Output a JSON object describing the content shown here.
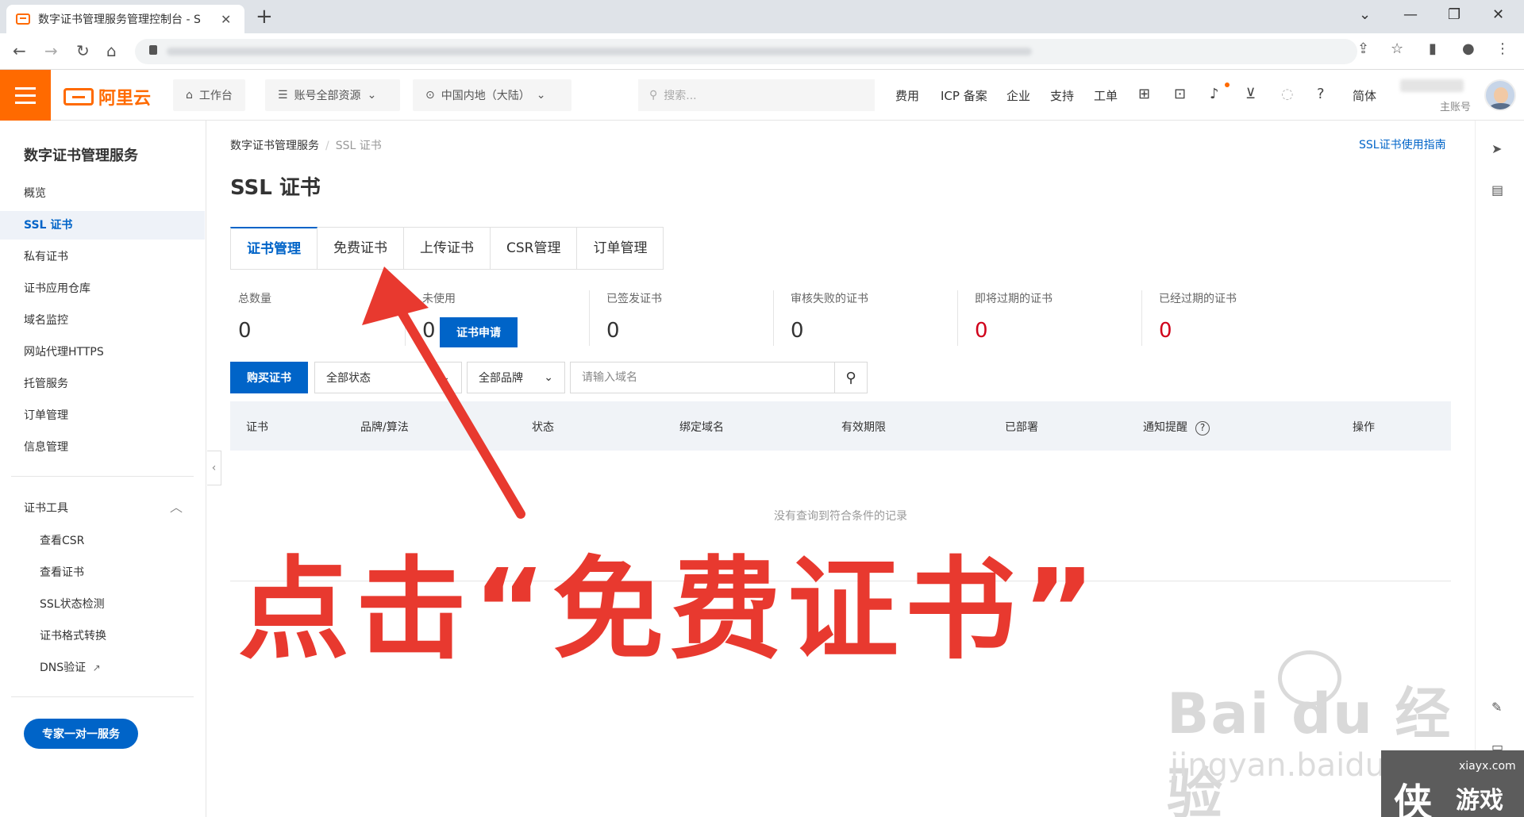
{
  "browser": {
    "tab_title": "数字证书管理服务管理控制台 - S",
    "tab_close": "✕",
    "new_tab": "+",
    "window_controls": [
      "⌄",
      "—",
      "❐",
      "✕"
    ]
  },
  "topnav": {
    "brand": "阿里云",
    "workbench": "工作台",
    "resources": "账号全部资源",
    "region": "中国内地（大陆）",
    "search_placeholder": "搜索...",
    "links": [
      "费用",
      "ICP 备案",
      "企业",
      "支持",
      "工单"
    ],
    "lang": "简体",
    "account_label": "主账号",
    "icons": [
      "grid-icon",
      "terminal-icon",
      "bell-icon",
      "cart-icon",
      "bulb-icon",
      "help-icon"
    ]
  },
  "sidebar": {
    "title": "数字证书管理服务",
    "items": [
      {
        "label": "概览"
      },
      {
        "label": "SSL 证书"
      },
      {
        "label": "私有证书"
      },
      {
        "label": "证书应用仓库"
      },
      {
        "label": "域名监控"
      },
      {
        "label": "网站代理HTTPS"
      },
      {
        "label": "托管服务"
      },
      {
        "label": "订单管理"
      },
      {
        "label": "信息管理"
      }
    ],
    "tools_group": "证书工具",
    "tools": [
      {
        "label": "查看CSR"
      },
      {
        "label": "查看证书"
      },
      {
        "label": "SSL状态检测"
      },
      {
        "label": "证书格式转换"
      },
      {
        "label": "DNS验证"
      }
    ],
    "expert_button": "专家一对一服务"
  },
  "main": {
    "breadcrumb": [
      "数字证书管理服务",
      "SSL 证书"
    ],
    "guide_link": "SSL证书使用指南",
    "title": "SSL 证书",
    "tabs": [
      "证书管理",
      "免费证书",
      "上传证书",
      "CSR管理",
      "订单管理"
    ],
    "stats": [
      {
        "label": "总数量",
        "value": "0"
      },
      {
        "label": "未使用",
        "value": "0"
      },
      {
        "label": "已签发证书",
        "value": "0"
      },
      {
        "label": "审核失败的证书",
        "value": "0"
      },
      {
        "label": "即将过期的证书",
        "value": "0"
      },
      {
        "label": "已经过期的证书",
        "value": "0"
      }
    ],
    "apply_button": "证书申请",
    "buy_button": "购买证书",
    "status_filter": "全部状态",
    "brand_filter": "全部品牌",
    "domain_placeholder": "请输入域名",
    "columns": [
      "证书",
      "品牌/算法",
      "状态",
      "绑定域名",
      "有效期限",
      "已部署",
      "通知提醒",
      "操作"
    ],
    "empty_text": "没有查询到符合条件的记录"
  },
  "annotation": {
    "text": "点击“免费证书”",
    "color": "#e8392f"
  },
  "watermark": {
    "main": "Bai du 经验",
    "sub": "jingyan.baidu.com"
  },
  "corner_logo": {
    "site": "xiayx.com",
    "big": "侠",
    "game": "游戏"
  },
  "colors": {
    "accent": "#0064c8",
    "brand": "#ff6a00",
    "danger": "#d0021b"
  }
}
